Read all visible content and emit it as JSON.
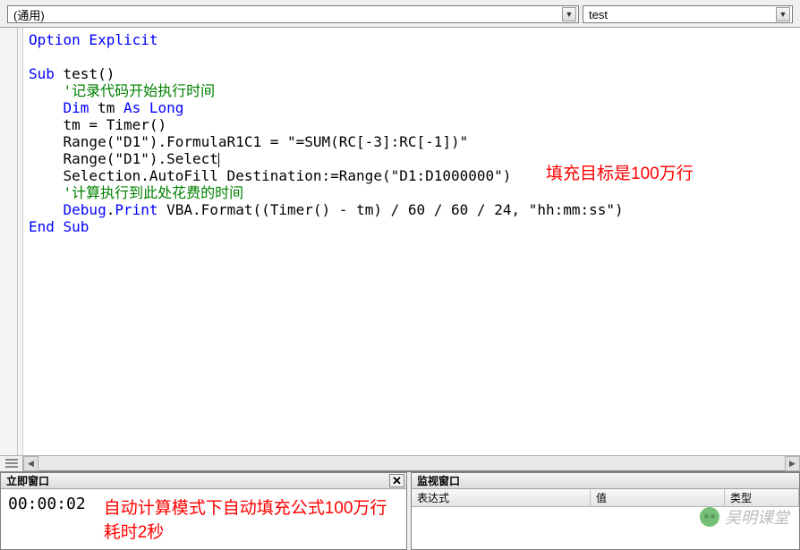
{
  "dropdowns": {
    "scope": "(通用)",
    "procedure": "test"
  },
  "code": {
    "l1_a": "Option Explicit",
    "l3_a": "Sub",
    "l3_b": " test()",
    "l4_a": "    '记录代码开始执行时间",
    "l5_a": "    ",
    "l5_b": "Dim",
    "l5_c": " tm ",
    "l5_d": "As Long",
    "l6_a": "    tm = Timer()",
    "l7_a": "    Range(\"D1\").FormulaR1C1 = \"=SUM(RC[-3]:RC[-1])\"",
    "l8_a": "    Range(\"D1\").Select",
    "l9_a": "    Selection.AutoFill Destination:=Range(\"D1:D1000000\")",
    "l10_a": "    '计算执行到此处花费的时间",
    "l11_a": "    ",
    "l11_b": "Debug",
    "l11_c": ".",
    "l11_d": "Print",
    "l11_e": " VBA.Format((Timer() - tm) / 60 / 60 / 24, \"hh:mm:ss\")",
    "l12_a": "End Sub"
  },
  "annotations": {
    "fill_target": "填充目标是100万行",
    "timing_note": "自动计算模式下自动填充公式100万行耗时2秒"
  },
  "immediate": {
    "title": "立即窗口",
    "output_time": "00:00:02"
  },
  "watch": {
    "title": "监视窗口",
    "col_expr": "表达式",
    "col_value": "值",
    "col_type": "类型"
  },
  "watermark": {
    "text": "吴明课堂"
  }
}
